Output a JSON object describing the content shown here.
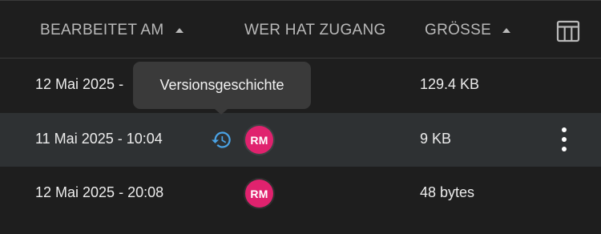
{
  "header": {
    "edited_label": "BEARBEITET AM",
    "access_label": "WER HAT ZUGANG",
    "size_label": "GRÖSSE",
    "edited_sort_icon": "sort-ascending-icon",
    "size_sort_icon": "sort-ascending-icon",
    "columns_icon": "table-columns-icon"
  },
  "tooltip": {
    "text": "Versionsgeschichte"
  },
  "rows": [
    {
      "edited": "12 Mai 2025 - ",
      "size": "129.4 KB",
      "selected": false
    },
    {
      "edited": "11 Mai 2025 - 10:04",
      "size": "9 KB",
      "avatar": "RM",
      "selected": true,
      "history_icon": "version-history-icon",
      "menu_icon": "more-vertical-icon"
    },
    {
      "edited": "12 Mai 2025 - 20:08",
      "size": "48 bytes",
      "avatar": "RM",
      "selected": false
    }
  ],
  "colors": {
    "background": "#1e1e1e",
    "selected_row": "#2e3133",
    "avatar": "#e0226e",
    "history_icon": "#4aa3e6"
  }
}
